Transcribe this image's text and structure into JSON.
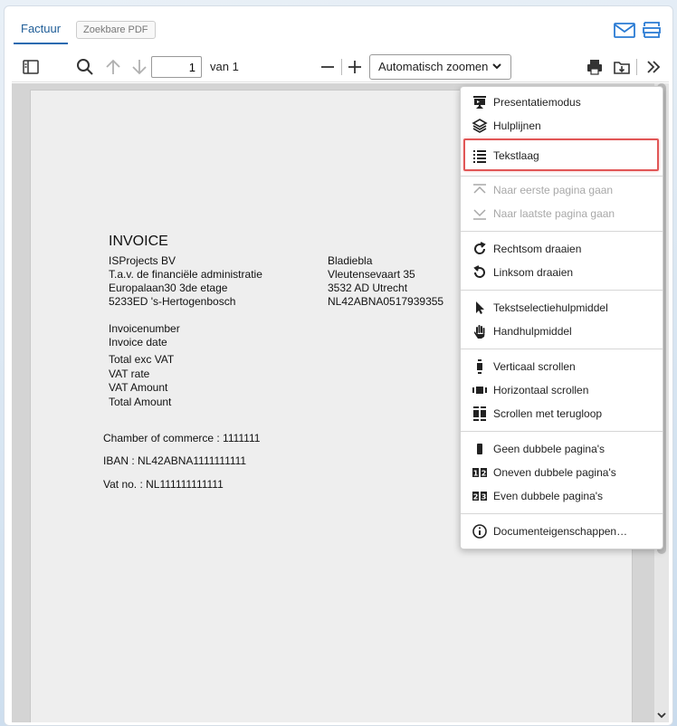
{
  "tabs": {
    "active": "Factuur",
    "secondary": "Zoekbare PDF"
  },
  "toolbar": {
    "page_current": "1",
    "page_count": "van 1",
    "zoom": "Automatisch zoomen"
  },
  "menu": {
    "items": [
      {
        "label": "Presentatiemodus",
        "icon": "presentation-icon"
      },
      {
        "label": "Hulplijnen",
        "icon": "layers-icon"
      },
      {
        "label": "Tekstlaag",
        "icon": "list-icon"
      },
      {
        "label": "Naar eerste pagina gaan",
        "icon": "first-page-icon"
      },
      {
        "label": "Naar laatste pagina gaan",
        "icon": "last-page-icon"
      },
      {
        "label": "Rechtsom draaien",
        "icon": "rotate-cw-icon"
      },
      {
        "label": "Linksom draaien",
        "icon": "rotate-ccw-icon"
      },
      {
        "label": "Tekstselectiehulpmiddel",
        "icon": "cursor-icon"
      },
      {
        "label": "Handhulpmiddel",
        "icon": "hand-icon"
      },
      {
        "label": "Verticaal scrollen",
        "icon": "vertical-scroll-icon"
      },
      {
        "label": "Horizontaal scrollen",
        "icon": "horizontal-scroll-icon"
      },
      {
        "label": "Scrollen met terugloop",
        "icon": "wrapped-scroll-icon"
      },
      {
        "label": "Geen dubbele pagina's",
        "icon": "single-page-icon"
      },
      {
        "label": "Oneven dubbele pagina's",
        "icon": "odd-spread-icon"
      },
      {
        "label": "Even dubbele pagina's",
        "icon": "even-spread-icon"
      },
      {
        "label": "Documenteigenschappen…",
        "icon": "info-icon"
      }
    ]
  },
  "invoice": {
    "title": "INVOICE",
    "sender": [
      "ISProjects BV",
      "T.a.v. de financiële administratie",
      "Europalaan30 3de etage",
      "5233ED 's-Hertogenbosch"
    ],
    "recipient": [
      "Bladiebla",
      "Vleutensevaart 35",
      "3532 AD Utrecht",
      "NL42ABNA0517939355"
    ],
    "fields": [
      "Invoicenumber",
      "Invoice date",
      "Total exc VAT",
      "VAT rate",
      "VAT Amount",
      "Total Amount"
    ],
    "chamber": "Chamber of commerce : 1111111",
    "iban": "IBAN : NL42ABNA1111111111",
    "vat_no": "Vat no. :  NL111111111111"
  }
}
